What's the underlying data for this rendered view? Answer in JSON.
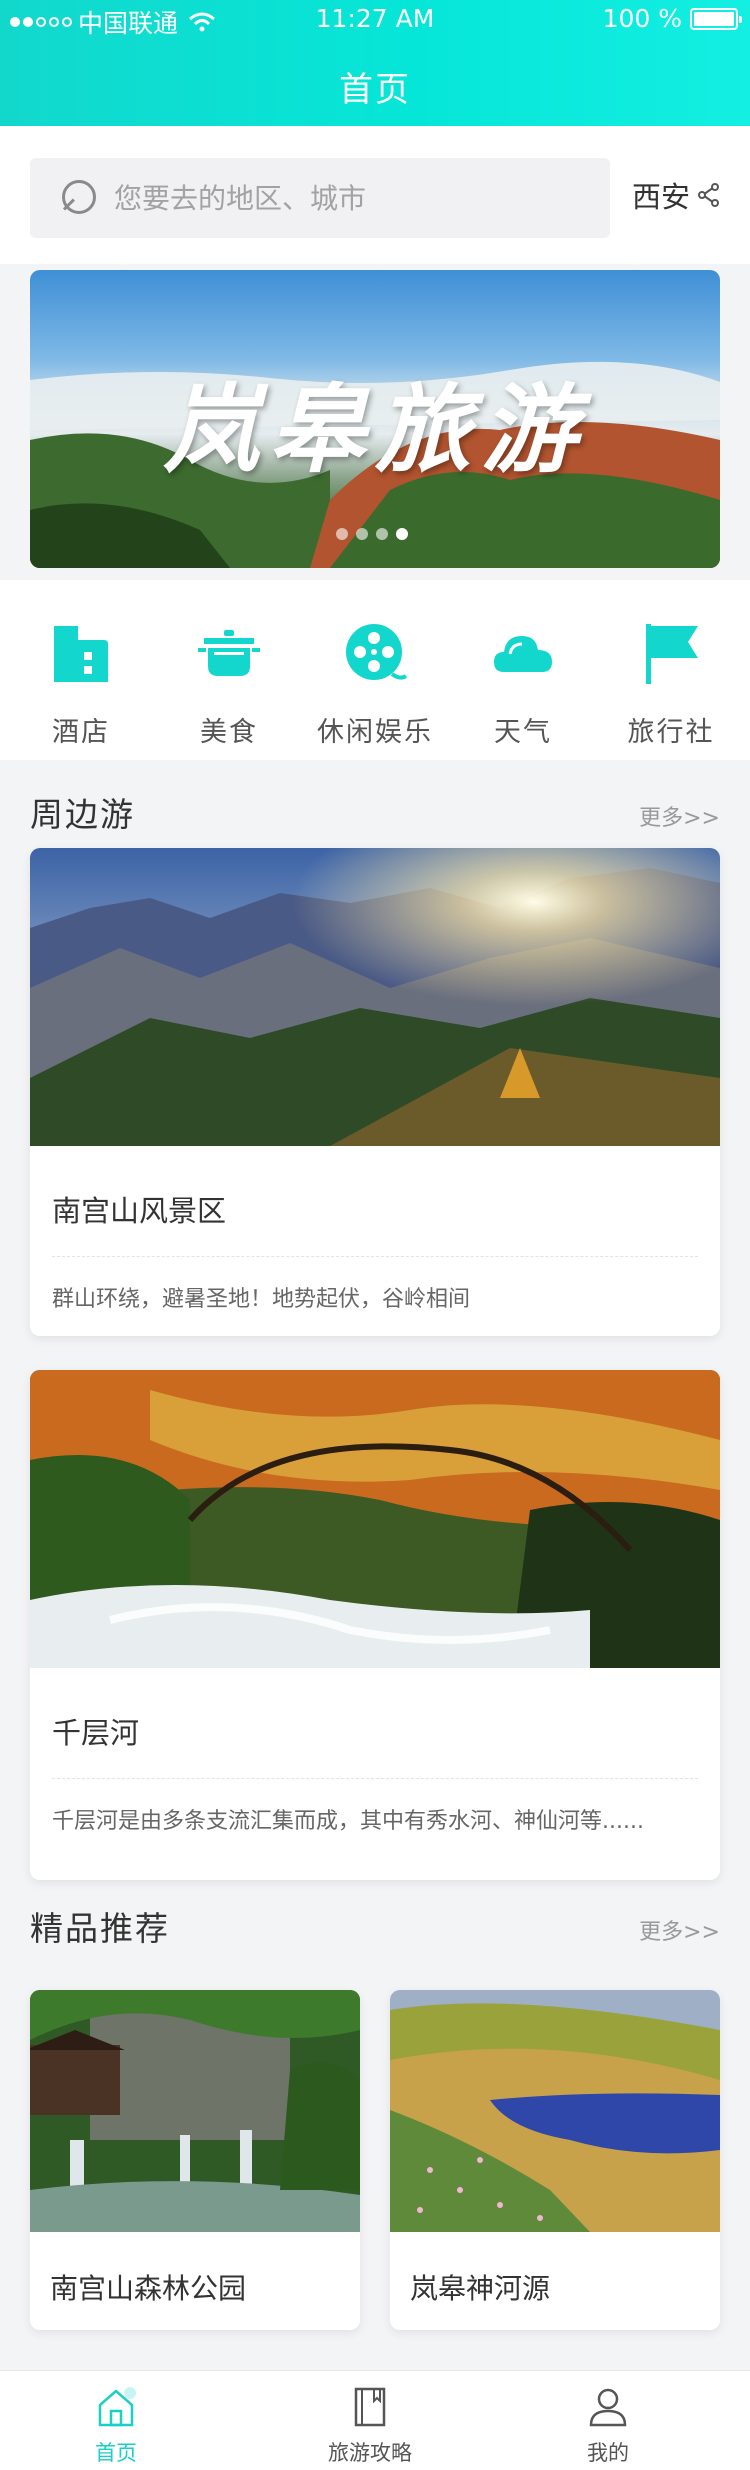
{
  "status_bar": {
    "carrier": "中国联通",
    "time": "11:27 AM",
    "battery": "100 %",
    "battery_level": 1.0,
    "signal_bars": 2
  },
  "header": {
    "title": "首页"
  },
  "search": {
    "placeholder": "您要去的地区、城市",
    "city": "西安"
  },
  "banner": {
    "title": "岚皋旅游",
    "page_count": 4,
    "active_page": 3
  },
  "categories": [
    {
      "label": "酒店",
      "icon": "hotel-icon"
    },
    {
      "label": "美食",
      "icon": "food-pot-icon"
    },
    {
      "label": "休闲娱乐",
      "icon": "film-reel-icon"
    },
    {
      "label": "天气",
      "icon": "cloud-icon"
    },
    {
      "label": "旅行社",
      "icon": "flag-icon"
    }
  ],
  "nearby": {
    "title": "周边游",
    "more": "更多>>",
    "items": [
      {
        "name": "南宫山风景区",
        "desc": "群山环绕，避暑圣地！地势起伏，谷岭相间"
      },
      {
        "name": "千层河",
        "desc": "千层河是由多条支流汇集而成，其中有秀水河、神仙河等......"
      }
    ]
  },
  "recommend": {
    "title": "精品推荐",
    "more": "更多>>",
    "items": [
      {
        "name": "南宫山森林公园"
      },
      {
        "name": "岚皋神河源"
      }
    ]
  },
  "tabbar": {
    "tabs": [
      {
        "label": "首页",
        "icon": "home-icon",
        "active": true
      },
      {
        "label": "旅游攻略",
        "icon": "guide-book-icon",
        "active": false
      },
      {
        "label": "我的",
        "icon": "user-icon",
        "active": false
      }
    ]
  },
  "colors": {
    "accent": "#0ae0d4",
    "tab_active": "#19cfc6",
    "icon": "#13d6cc"
  }
}
